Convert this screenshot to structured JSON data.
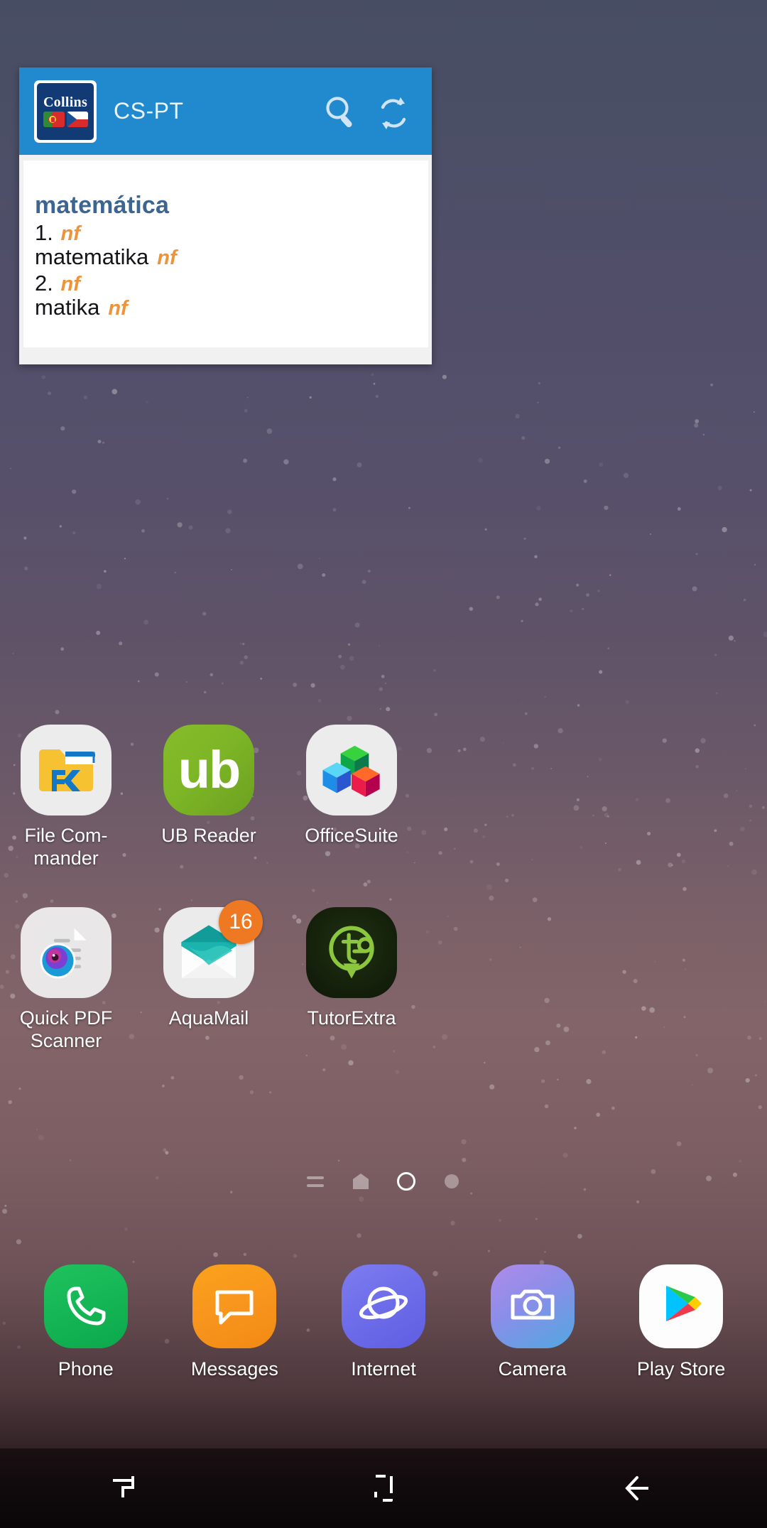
{
  "widget": {
    "app_icon_name": "collins-dictionary-icon",
    "brand": "Collins",
    "title": "CS-PT",
    "header_color": "#2189ce",
    "search_icon": "search-icon",
    "swap_icon": "refresh-swap-icon",
    "entry": {
      "headword": "matemática",
      "headword_color": "#3d6591",
      "pos_color": "#ef933a",
      "senses": [
        {
          "number": "1.",
          "pos": "nf",
          "translation": "matematika",
          "translation_pos": "nf"
        },
        {
          "number": "2.",
          "pos": "nf",
          "translation": "matika",
          "translation_pos": "nf"
        }
      ]
    }
  },
  "home": {
    "rows": [
      [
        {
          "label": "File Com-\nmander",
          "icon": "file-commander-icon",
          "badge": null
        },
        {
          "label": "UB Reader",
          "icon": "ub-reader-icon",
          "badge": null
        },
        {
          "label": "OfficeSuite",
          "icon": "officesuite-icon",
          "badge": null
        }
      ],
      [
        {
          "label": "Quick PDF\nScanner",
          "icon": "quick-pdf-scanner-icon",
          "badge": null
        },
        {
          "label": "AquaMail",
          "icon": "aquamail-icon",
          "badge": "16"
        },
        {
          "label": "TutorExtra",
          "icon": "tutorextra-icon",
          "badge": null
        }
      ]
    ],
    "page_indicators": [
      {
        "type": "lines",
        "active": false
      },
      {
        "type": "home",
        "active": false
      },
      {
        "type": "ring",
        "active": true
      },
      {
        "type": "dot",
        "active": false
      }
    ]
  },
  "dock": {
    "items": [
      {
        "label": "Phone",
        "icon": "phone-icon"
      },
      {
        "label": "Messages",
        "icon": "messages-icon"
      },
      {
        "label": "Internet",
        "icon": "internet-browser-icon"
      },
      {
        "label": "Camera",
        "icon": "camera-icon"
      },
      {
        "label": "Play Store",
        "icon": "play-store-icon"
      }
    ]
  },
  "navbar": {
    "items": [
      {
        "name": "recents",
        "icon": "recents-icon"
      },
      {
        "name": "home",
        "icon": "home-icon"
      },
      {
        "name": "back",
        "icon": "back-arrow-icon"
      }
    ]
  },
  "colors": {
    "widget_blue": "#2189ce",
    "headword_blue": "#3d6591",
    "pos_orange": "#ef933a",
    "badge_orange": "#ef7822"
  }
}
